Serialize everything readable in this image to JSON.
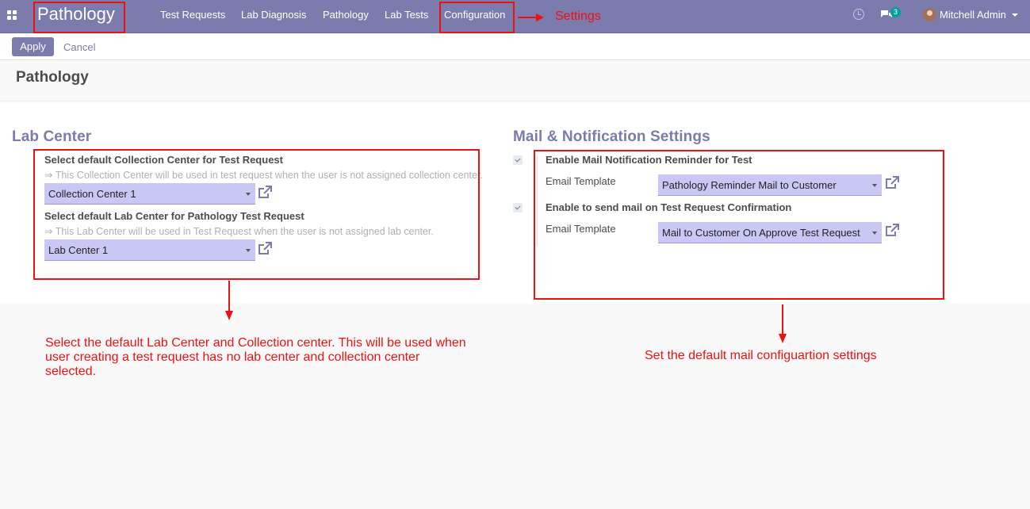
{
  "navbar": {
    "brand": "Pathology",
    "menu": [
      "Test Requests",
      "Lab Diagnosis",
      "Pathology",
      "Lab Tests",
      "Configuration"
    ],
    "chat_count": "3",
    "user_name": "Mitchell Admin"
  },
  "control_panel": {
    "apply_label": "Apply",
    "cancel_label": "Cancel"
  },
  "settings": {
    "title": "Pathology"
  },
  "lab_center": {
    "title": "Lab Center",
    "collection_label": "Select default Collection Center for Test Request",
    "collection_help": "⇒ This Collection Center will be used in test request when the user is not assigned collection center.",
    "collection_value": "Collection Center 1",
    "lab_label": "Select default Lab Center for Pathology Test Request",
    "lab_help": "⇒ This Lab Center will be used in Test Request when the user is not assigned lab center.",
    "lab_value": "Lab Center 1"
  },
  "mail": {
    "title": "Mail & Notification Settings",
    "reminder_label": "Enable Mail Notification Reminder for Test",
    "template_label_1": "Email Template",
    "template_value_1": "Pathology Reminder Mail to Customer",
    "confirm_label": "Enable to send mail on Test Request Confirmation",
    "template_label_2": "Email Template",
    "template_value_2": "Mail to Customer On Approve Test Request"
  },
  "annotations": {
    "settings_note": "Settings",
    "lab_note": "Select the default Lab Center and Collection center. This will be used when user creating a test request has no lab center and collection center selected.",
    "mail_note": "Set the default mail configuartion settings"
  },
  "colors": {
    "navbar": "#7c7bad",
    "annotation": "#ee1111",
    "select_bg": "#c9c8f5"
  }
}
